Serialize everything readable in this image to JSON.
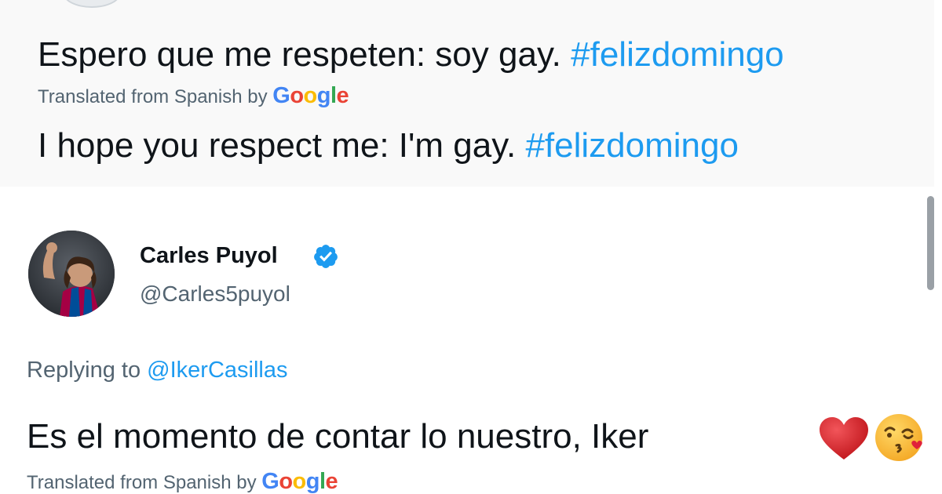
{
  "top_tweet": {
    "original_text": "Espero que me respeten: soy gay.",
    "original_hashtag": "#felizdomingo",
    "translated_label": "Translated from Spanish by",
    "google_letters": [
      "G",
      "o",
      "o",
      "g",
      "l",
      "e"
    ],
    "translation_text": "I hope you respect me: I'm gay.",
    "translation_hashtag": "#felizdomingo"
  },
  "reply_tweet": {
    "author_name": "Carles Puyol",
    "handle": "@Carles5puyol",
    "replying_label": "Replying to",
    "replying_to": "@IkerCasillas",
    "text": "Es el momento de contar lo nuestro, Iker",
    "emojis": [
      "heart-icon",
      "face-blowing-kiss-icon"
    ],
    "translated_label": "Translated from Spanish by",
    "google_letters": [
      "G",
      "o",
      "o",
      "g",
      "l",
      "e"
    ]
  },
  "colors": {
    "link": "#1d9bf0",
    "secondary": "#536471",
    "verified": "#1d9bf0"
  }
}
